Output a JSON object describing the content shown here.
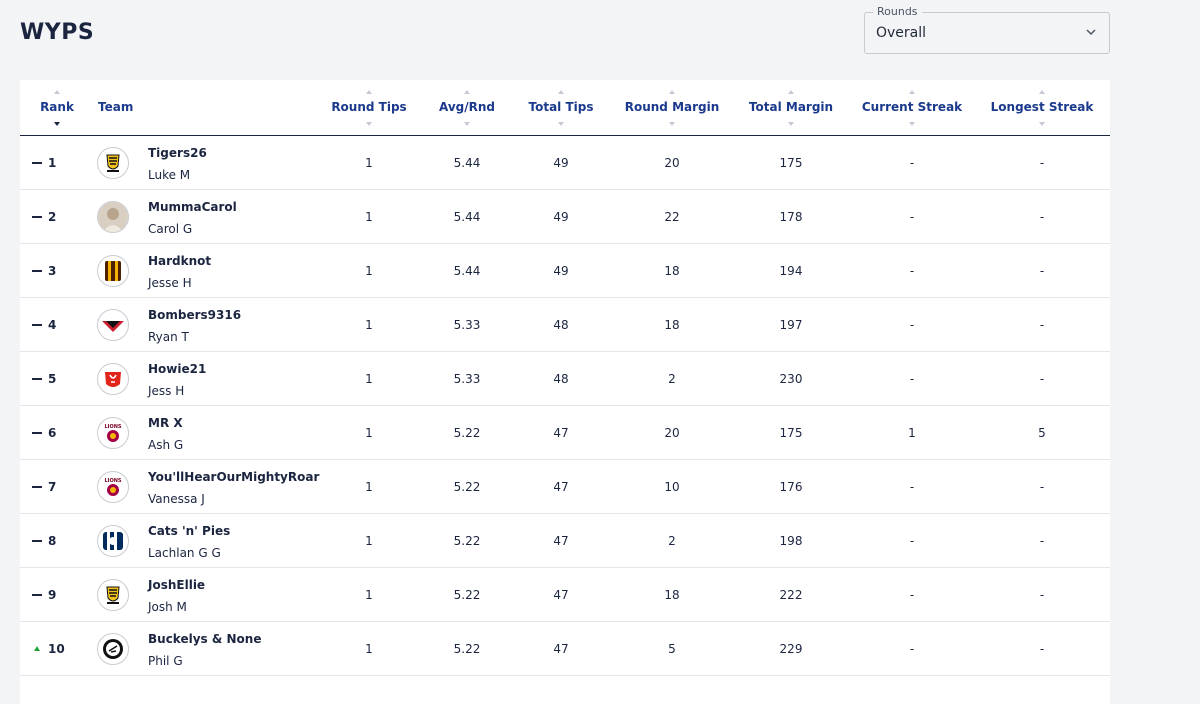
{
  "page": {
    "title": "WYPS"
  },
  "rounds": {
    "label": "Rounds",
    "selected": "Overall"
  },
  "table": {
    "headers": {
      "rank": "Rank",
      "team": "Team",
      "round_tips": "Round Tips",
      "avg_rnd": "Avg/Rnd",
      "total_tips": "Total Tips",
      "round_margin": "Round Margin",
      "total_margin": "Total Margin",
      "current_streak": "Current Streak",
      "longest_streak": "Longest Streak"
    },
    "rows": [
      {
        "rank": "1",
        "movement": "same",
        "logo": "tigers-logo",
        "team": "Tigers26",
        "user": "Luke M",
        "round_tips": "1",
        "avg_rnd": "5.44",
        "total_tips": "49",
        "round_margin": "20",
        "total_margin": "175",
        "current_streak": "-",
        "longest_streak": "-"
      },
      {
        "rank": "2",
        "movement": "same",
        "logo": "user-photo-avatar",
        "team": "MummaCarol",
        "user": "Carol G",
        "round_tips": "1",
        "avg_rnd": "5.44",
        "total_tips": "49",
        "round_margin": "22",
        "total_margin": "178",
        "current_streak": "-",
        "longest_streak": "-"
      },
      {
        "rank": "3",
        "movement": "same",
        "logo": "hawks-logo",
        "team": "Hardknot",
        "user": "Jesse H",
        "round_tips": "1",
        "avg_rnd": "5.44",
        "total_tips": "49",
        "round_margin": "18",
        "total_margin": "194",
        "current_streak": "-",
        "longest_streak": "-"
      },
      {
        "rank": "4",
        "movement": "same",
        "logo": "bombers-logo",
        "team": "Bombers9316",
        "user": "Ryan T",
        "round_tips": "1",
        "avg_rnd": "5.33",
        "total_tips": "48",
        "round_margin": "18",
        "total_margin": "197",
        "current_streak": "-",
        "longest_streak": "-"
      },
      {
        "rank": "5",
        "movement": "same",
        "logo": "swans-logo",
        "team": "Howie21",
        "user": "Jess H",
        "round_tips": "1",
        "avg_rnd": "5.33",
        "total_tips": "48",
        "round_margin": "2",
        "total_margin": "230",
        "current_streak": "-",
        "longest_streak": "-"
      },
      {
        "rank": "6",
        "movement": "same",
        "logo": "lions-logo",
        "team": "MR X",
        "user": "Ash G",
        "round_tips": "1",
        "avg_rnd": "5.22",
        "total_tips": "47",
        "round_margin": "20",
        "total_margin": "175",
        "current_streak": "1",
        "longest_streak": "5"
      },
      {
        "rank": "7",
        "movement": "same",
        "logo": "lions-logo",
        "team": "You'llHearOurMightyRoar",
        "user": "Vanessa J",
        "round_tips": "1",
        "avg_rnd": "5.22",
        "total_tips": "47",
        "round_margin": "10",
        "total_margin": "176",
        "current_streak": "-",
        "longest_streak": "-"
      },
      {
        "rank": "8",
        "movement": "same",
        "logo": "cats-logo",
        "team": "Cats 'n' Pies",
        "user": "Lachlan G G",
        "round_tips": "1",
        "avg_rnd": "5.22",
        "total_tips": "47",
        "round_margin": "2",
        "total_margin": "198",
        "current_streak": "-",
        "longest_streak": "-"
      },
      {
        "rank": "9",
        "movement": "same",
        "logo": "tigers-logo",
        "team": "JoshEllie",
        "user": "Josh M",
        "round_tips": "1",
        "avg_rnd": "5.22",
        "total_tips": "47",
        "round_margin": "18",
        "total_margin": "222",
        "current_streak": "-",
        "longest_streak": "-"
      },
      {
        "rank": "10",
        "movement": "up",
        "logo": "magpies-logo",
        "team": "Buckelys & None",
        "user": "Phil G",
        "round_tips": "1",
        "avg_rnd": "5.22",
        "total_tips": "47",
        "round_margin": "5",
        "total_margin": "229",
        "current_streak": "-",
        "longest_streak": "-"
      }
    ]
  },
  "colors": {
    "header_text": "#1b3a8c",
    "title": "#1b2540",
    "up_arrow": "#22a63a"
  }
}
